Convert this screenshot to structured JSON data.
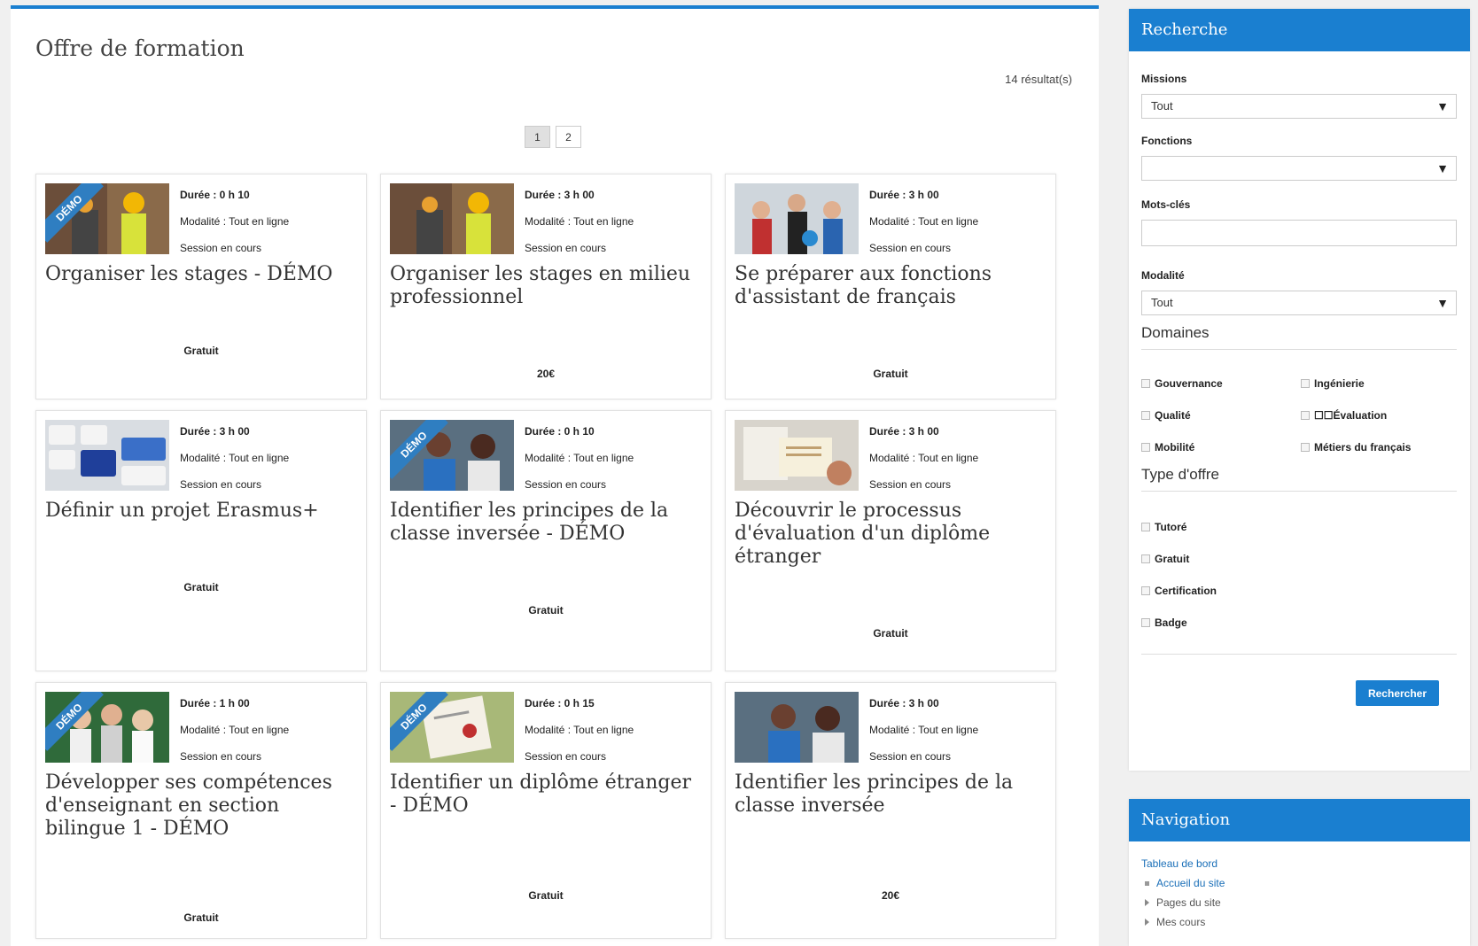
{
  "page": {
    "title": "Offre de formation",
    "results": "14 résultat(s)",
    "pages": [
      "1",
      "2"
    ]
  },
  "courses": [
    {
      "title": "Organiser les stages - DÉMO",
      "duration": "Durée : 0 h 10",
      "modality": "Modalité : Tout en ligne",
      "session": "Session en cours",
      "price": "Gratuit",
      "ribbon": "DÉMO",
      "thumb": "workers-icon"
    },
    {
      "title": "Organiser les stages en milieu professionnel",
      "duration": "Durée : 3 h 00",
      "modality": "Modalité : Tout en ligne",
      "session": "Session en cours",
      "price": "20€",
      "ribbon": "",
      "thumb": "workers-icon"
    },
    {
      "title": "Se préparer aux fonctions d'assistant de français",
      "duration": "Durée : 3 h 00",
      "modality": "Modalité : Tout en ligne",
      "session": "Session en cours",
      "price": "Gratuit",
      "ribbon": "",
      "thumb": "classroom-icon"
    },
    {
      "title": "Définir un projet Erasmus+",
      "duration": "Durée : 3 h 00",
      "modality": "Modalité : Tout en ligne",
      "session": "Session en cours",
      "price": "Gratuit",
      "ribbon": "",
      "thumb": "keyboard-icon"
    },
    {
      "title": "Identifier les principes de la classe inversée - DÉMO",
      "duration": "Durée : 0 h 10",
      "modality": "Modalité : Tout en ligne",
      "session": "Session en cours",
      "price": "Gratuit",
      "ribbon": "DÉMO",
      "thumb": "students-icon"
    },
    {
      "title": "Découvrir le processus d'évaluation d'un diplôme étranger",
      "duration": "Durée : 3 h 00",
      "modality": "Modalité : Tout en ligne",
      "session": "Session en cours",
      "price": "Gratuit",
      "ribbon": "",
      "thumb": "documents-icon"
    },
    {
      "title": "Développer ses compétences d'enseignant en section bilingue 1 - DÉMO",
      "duration": "Durée : 1 h 00",
      "modality": "Modalité : Tout en ligne",
      "session": "Session en cours",
      "price": "Gratuit",
      "ribbon": "DÉMO",
      "thumb": "group-icon"
    },
    {
      "title": "Identifier un diplôme étranger - DÉMO",
      "duration": "Durée : 0 h 15",
      "modality": "Modalité : Tout en ligne",
      "session": "Session en cours",
      "price": "Gratuit",
      "ribbon": "DÉMO",
      "thumb": "diploma-icon"
    },
    {
      "title": "Identifier les principes de la classe inversée",
      "duration": "Durée : 3 h 00",
      "modality": "Modalité : Tout en ligne",
      "session": "Session en cours",
      "price": "20€",
      "ribbon": "",
      "thumb": "students-icon"
    }
  ],
  "search": {
    "title": "Recherche",
    "missions_label": "Missions",
    "missions_value": "Tout",
    "fonctions_label": "Fonctions",
    "fonctions_value": "",
    "keywords_label": "Mots-clés",
    "keywords_value": "",
    "modality_label": "Modalité",
    "modality_value": "Tout",
    "domains_label": "Domaines",
    "domains": [
      "Gouvernance",
      "Ingénierie",
      "Qualité",
      "☐☐Évaluation",
      "Mobilité",
      "Métiers du français"
    ],
    "offer_label": "Type d'offre",
    "offers": [
      "Tutoré",
      "Gratuit",
      "Certification",
      "Badge"
    ],
    "button": "Rechercher"
  },
  "navigation": {
    "title": "Navigation",
    "dashboard": "Tableau de bord",
    "items": [
      "Accueil du site",
      "Pages du site",
      "Mes cours"
    ]
  },
  "colors": {
    "accent": "#1a7fd0",
    "ribbon": "#2f7ec1"
  }
}
